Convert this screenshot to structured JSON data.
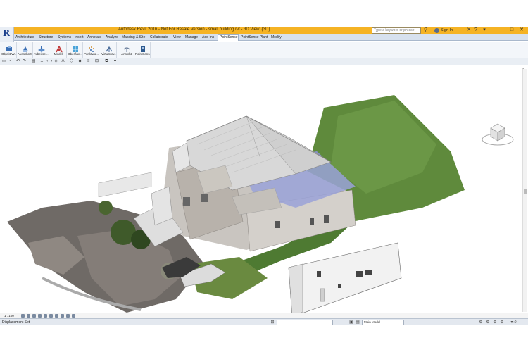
{
  "window": {
    "title": "Autodesk Revit 2016 -  Not For Resale Version -     small building.rvt - 3D View: {3D}",
    "app_logo": "R",
    "search_placeholder": "Type a keyword or phrase",
    "signin_label": "Sign In",
    "controls": [
      "–",
      "□",
      "✕"
    ]
  },
  "menu": {
    "tabs": [
      "Architecture",
      "Structure",
      "Systems",
      "Insert",
      "Annotate",
      "Analyze",
      "Massing & Site",
      "Collaborate",
      "View",
      "Manage",
      "Add-Ins",
      "PointSense",
      "PointSense Plant",
      "Modify"
    ],
    "active": "PointSense"
  },
  "ribbon": {
    "buttons": [
      {
        "label": "Objekt W...",
        "icon": "object-icon",
        "color": "#3a6fb5"
      },
      {
        "label": "Ausschnitte",
        "icon": "section-icon",
        "color": "#3a6fb5"
      },
      {
        "label": "Arbeitse...",
        "icon": "workplane-icon",
        "color": "#5d8ecb"
      },
      {
        "label": "Modell",
        "icon": "model-icon",
        "color": "#c23c3c"
      },
      {
        "label": "Oberfläc...",
        "icon": "surface-icon",
        "color": "#4aa3d8"
      },
      {
        "label": "Punktwo...",
        "icon": "pointcloud-icon",
        "color": "#d08b2a"
      },
      {
        "label": "VirtuSurv...",
        "icon": "virtusurv-icon",
        "color": "#4d6f9d"
      },
      {
        "label": "Ansicht",
        "icon": "view-icon",
        "color": "#6b7f9c"
      },
      {
        "label": "PointSense",
        "icon": "pointsense-icon",
        "color": "#2e5a8e"
      }
    ]
  },
  "statusbar": {
    "scale": "1 : 100",
    "status": "Displacement Set",
    "workset_value": "Main Model",
    "filter_count": ":0"
  },
  "canvas": {
    "background": "#ffffff",
    "viewcube_label": "3D"
  }
}
